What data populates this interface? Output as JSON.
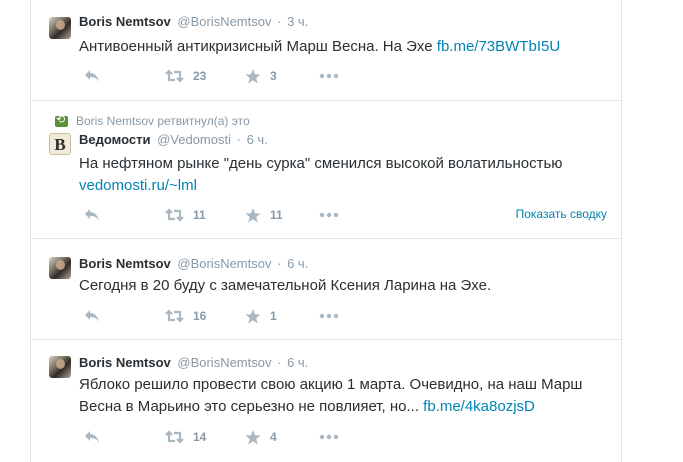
{
  "tweets": [
    {
      "context": "",
      "fullname": "Boris Nemtsov",
      "username": "@BorisNemtsov",
      "dot": "·",
      "time": "3 ч.",
      "line1": "Антивоенный антикризисный Марш Весна.  На Эхе ",
      "line1_link": "fb.me/73BWTbI5U",
      "line2": "",
      "line2_link": "",
      "retweets": "23",
      "favorites": "3",
      "summary": ""
    },
    {
      "context": "Boris Nemtsov ретвитнул(а) это",
      "fullname": "Ведомости",
      "username": "@Vedomosti",
      "dot": "·",
      "time": "6 ч.",
      "line1": "На нефтяном рынке \"день сурка\" сменился высокой волатильностью",
      "line1_link": "",
      "line2": "",
      "line2_link": "vedomosti.ru/~lml",
      "retweets": "11",
      "favorites": "11",
      "summary": "Показать сводку",
      "avatar_letter": "B"
    },
    {
      "context": "",
      "fullname": "Boris Nemtsov",
      "username": "@BorisNemtsov",
      "dot": "·",
      "time": "6 ч.",
      "line1": "Сегодня в 20 буду с замечательной Ксения Ларина на Эхе.",
      "line1_link": "",
      "line2": "",
      "line2_link": "",
      "retweets": "16",
      "favorites": "1",
      "summary": ""
    },
    {
      "context": "",
      "fullname": "Boris Nemtsov",
      "username": "@BorisNemtsov",
      "dot": "·",
      "time": "6 ч.",
      "line1": "Яблоко решило провести свою акцию 1 марта.  Очевидно, на наш Марш",
      "line1_link": "",
      "line2": "Весна в Марьино это серьезно не повлияет, но... ",
      "line2_link": "fb.me/4ka8ozjsD",
      "retweets": "14",
      "favorites": "4",
      "summary": ""
    }
  ],
  "colors": {
    "link": "#0084b4",
    "muted": "#8899a6",
    "text": "#292f33",
    "retweet_context": "#5c913b"
  },
  "icons": [
    "reply-icon",
    "retweet-icon",
    "favorite-star-icon",
    "more-dots-icon",
    "retweet-context-icon"
  ]
}
